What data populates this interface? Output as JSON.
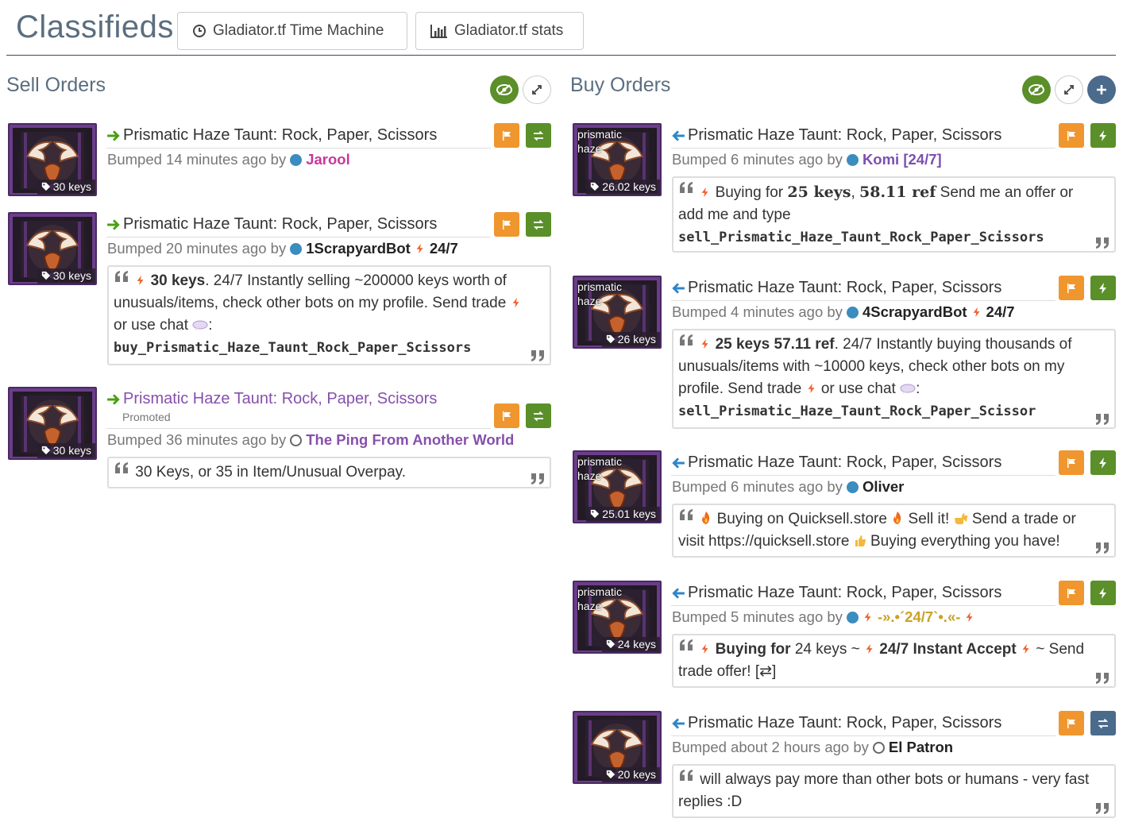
{
  "header": {
    "title": "Classifieds",
    "buttons": [
      {
        "label": "Gladiator.tf Time Machine",
        "icon": "clock-icon"
      },
      {
        "label": "Gladiator.tf stats",
        "icon": "bar-chart-icon"
      }
    ]
  },
  "sell": {
    "title": "Sell Orders",
    "listings": [
      {
        "name": "Prismatic Haze Taunt: Rock, Paper, Scissors",
        "price": "30 keys",
        "bumped": "Bumped 14 minutes ago by",
        "user": "Jarool",
        "user_color": "#c8379b"
      },
      {
        "name": "Prismatic Haze Taunt: Rock, Paper, Scissors",
        "price": "30 keys",
        "bumped": "Bumped 20 minutes ago by",
        "user": "1ScrapyardBot",
        "user_suffix": "24/7",
        "comment": {
          "a": "30 keys",
          "b": ". 24/7 Instantly selling ~200000 keys worth of unusuals/items, check other bots on my profile. Send trade",
          "c": "or use chat",
          "d": ":",
          "cmd": "buy_Prismatic_Haze_Taunt_Rock_Paper_Scissors"
        }
      },
      {
        "name": "Prismatic Haze Taunt: Rock, Paper, Scissors",
        "promoted": "Promoted",
        "price": "30 keys",
        "bumped": "Bumped 36 minutes ago by",
        "user": "The Ping From Another World",
        "user_color": "#8650ac",
        "comment": {
          "text": "30 Keys, or 35 in Item/Unusual Overpay."
        }
      }
    ]
  },
  "buy": {
    "title": "Buy Orders",
    "listings": [
      {
        "name": "Prismatic Haze Taunt: Rock, Paper, Scissors",
        "thumb_label": "prismatic haze",
        "price": "26.02 keys",
        "bumped": "Bumped 6 minutes ago by",
        "user": "Komi [24/7]",
        "user_color": "#7b4fb0",
        "comment": {
          "a": "Buying for",
          "b": "25 keys",
          "c": ",",
          "d": "58.11 ref",
          "e": "Send me an offer or add me and type",
          "cmd": "sell_Prismatic_Haze_Taunt_Rock_Paper_Scissors"
        }
      },
      {
        "name": "Prismatic Haze Taunt: Rock, Paper, Scissors",
        "thumb_label": "prismatic haze",
        "price": "26 keys",
        "bumped": "Bumped 4 minutes ago by",
        "user": "4ScrapyardBot",
        "user_suffix": "24/7",
        "comment": {
          "a": "25 keys 57.11 ref",
          "b": ". 24/7 Instantly buying thousands of unusuals/items with ~10000 keys, check other bots on my profile. Send trade",
          "c": "or use chat",
          "d": ":",
          "cmd": "sell_Prismatic_Haze_Taunt_Rock_Paper_Scissor"
        }
      },
      {
        "name": "Prismatic Haze Taunt: Rock, Paper, Scissors",
        "thumb_label": "prismatic haze",
        "price": "25.01 keys",
        "bumped": "Bumped 6 minutes ago by",
        "user": "Oliver",
        "comment": {
          "a": "Buying on Quicksell.store",
          "b": "Sell it!",
          "c": "Send a trade or visit https://quicksell.store",
          "d": "Buying everything you have!"
        }
      },
      {
        "name": "Prismatic Haze Taunt: Rock, Paper, Scissors",
        "thumb_label": "prismatic haze",
        "price": "24 keys",
        "bumped": "Bumped 5 minutes ago by",
        "user": "-».•´24/7`•.«-",
        "user_color": "#c9a227",
        "comment": {
          "a": "Buying for",
          "b": "24 keys ~",
          "c": "24/7 Instant Accept",
          "d": "~ Send trade offer! [⇄]"
        }
      },
      {
        "name": "Prismatic Haze Taunt: Rock, Paper, Scissors",
        "price": "20 keys",
        "bumped": "Bumped about 2 hours ago by",
        "user": "El Patron",
        "comment": {
          "text": "will always pay more than other bots or humans - very fast replies :D"
        }
      }
    ]
  },
  "colors": {
    "orange": "#f0962e",
    "green": "#5a8f29",
    "slate": "#4b6b8c",
    "purple_frame": "#6b3d8a",
    "blue_dot": "#3b8cbf"
  }
}
